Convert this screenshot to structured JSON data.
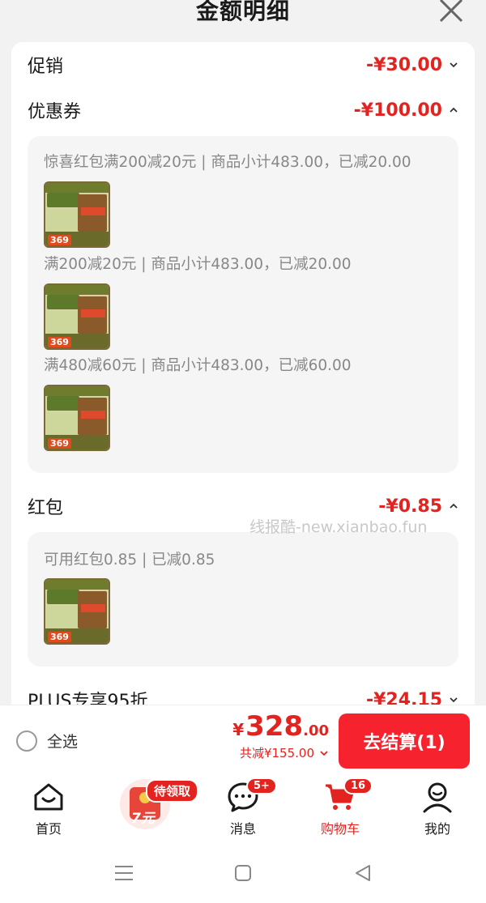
{
  "header": {
    "title": "金额明细",
    "close_icon": "close-icon"
  },
  "rows": {
    "promo": {
      "label": "促销",
      "amount": "-¥30.00"
    },
    "coupon": {
      "label": "优惠券",
      "amount": "-¥100.00"
    },
    "redpacket": {
      "label": "红包",
      "amount": "-¥0.85"
    },
    "plus": {
      "label": "PLUS专享95折",
      "amount": "-¥24.15"
    }
  },
  "coupon_panel": {
    "lines": [
      "惊喜红包满200减20元 | 商品小计483.00，已减20.00",
      "满200减20元 | 商品小计483.00，已减20.00",
      "满480减60元 | 商品小计483.00，已减60.00"
    ],
    "thumb_price": "369"
  },
  "redpacket_panel": {
    "line": "可用红包0.85 | 已减0.85",
    "thumb_price": "369"
  },
  "watermark": "线报酷-new.xianbao.fun",
  "checkout": {
    "select_all": "全选",
    "currency": "¥",
    "price_int": "328",
    "price_dec": ".00",
    "saved": "共减¥155.00",
    "pay_button": "去结算(1)"
  },
  "tabbar": {
    "home": "首页",
    "promo_badge": "待领取",
    "promo_amount": "7元",
    "messages": "消息",
    "messages_badge": "5+",
    "cart": "购物车",
    "cart_badge": "16",
    "mine": "我的"
  },
  "colors": {
    "accent": "#e3231f",
    "pay_button": "#f6232e"
  }
}
